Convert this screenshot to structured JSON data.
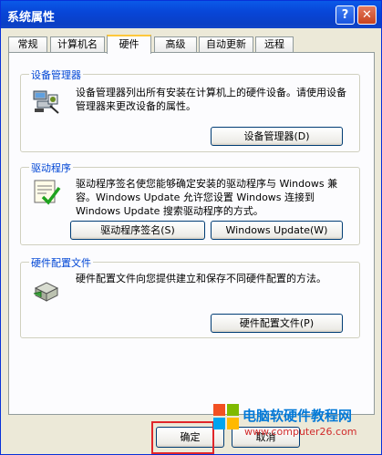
{
  "window": {
    "title": "系统属性",
    "help_glyph": "?",
    "close_glyph": "✕"
  },
  "tabs": [
    {
      "label": "常规"
    },
    {
      "label": "计算机名"
    },
    {
      "label": "硬件"
    },
    {
      "label": "高级"
    },
    {
      "label": "自动更新"
    },
    {
      "label": "远程"
    }
  ],
  "active_tab": "硬件",
  "groups": {
    "device_manager": {
      "title": "设备管理器",
      "description": "设备管理器列出所有安装在计算机上的硬件设备。请使用设备管理器来更改设备的属性。",
      "button": "设备管理器(D)",
      "icon": "device-manager-icon"
    },
    "drivers": {
      "title": "驱动程序",
      "description": "驱动程序签名使您能够确定安装的驱动程序与 Windows 兼容。Windows Update 允许您设置 Windows 连接到 Windows Update 搜索驱动程序的方式。",
      "button_signing": "驱动程序签名(S)",
      "button_update": "Windows Update(W)",
      "icon": "driver-signing-icon"
    },
    "hardware_profiles": {
      "title": "硬件配置文件",
      "description": "硬件配置文件向您提供建立和保存不同硬件配置的方法。",
      "button": "硬件配置文件(P)",
      "icon": "hardware-profile-icon"
    }
  },
  "footer": {
    "ok": "确定",
    "cancel": "取消"
  },
  "watermark": {
    "title": "电脑软硬件教程网",
    "url": "www.computer26.com"
  },
  "colors": {
    "titlebar": "#0a5ae8",
    "group_title": "#0046d5",
    "highlight": "#e0262a",
    "watermark_title": "#0078d7"
  }
}
